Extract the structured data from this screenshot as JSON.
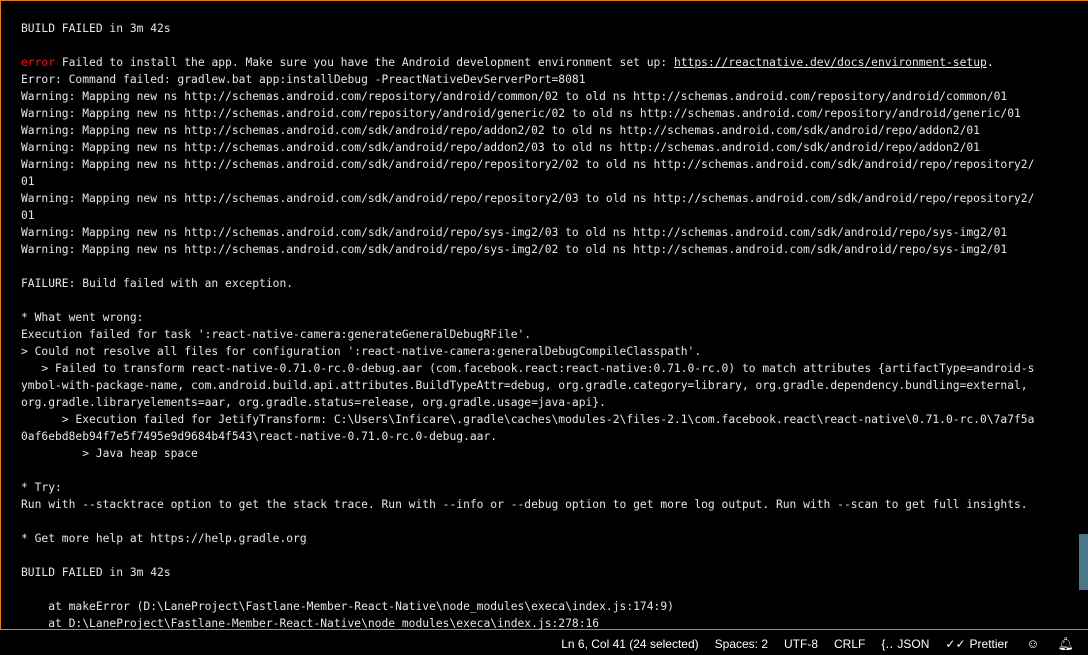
{
  "terminal": {
    "lines": [
      {
        "text": "BUILD FAILED in 3m 42s"
      },
      {
        "text": ""
      },
      {
        "prefix": "error",
        "text": " Failed to install the app. Make sure you have the Android development environment set up: ",
        "link": "https://reactnative.dev/docs/environment-setup",
        "suffix": "."
      },
      {
        "text": "Error: Command failed: gradlew.bat app:installDebug -PreactNativeDevServerPort=8081"
      },
      {
        "text": "Warning: Mapping new ns http://schemas.android.com/repository/android/common/02 to old ns http://schemas.android.com/repository/android/common/01"
      },
      {
        "text": "Warning: Mapping new ns http://schemas.android.com/repository/android/generic/02 to old ns http://schemas.android.com/repository/android/generic/01"
      },
      {
        "text": "Warning: Mapping new ns http://schemas.android.com/sdk/android/repo/addon2/02 to old ns http://schemas.android.com/sdk/android/repo/addon2/01"
      },
      {
        "text": "Warning: Mapping new ns http://schemas.android.com/sdk/android/repo/addon2/03 to old ns http://schemas.android.com/sdk/android/repo/addon2/01"
      },
      {
        "text": "Warning: Mapping new ns http://schemas.android.com/sdk/android/repo/repository2/02 to old ns http://schemas.android.com/sdk/android/repo/repository2/"
      },
      {
        "text": "01"
      },
      {
        "text": "Warning: Mapping new ns http://schemas.android.com/sdk/android/repo/repository2/03 to old ns http://schemas.android.com/sdk/android/repo/repository2/"
      },
      {
        "text": "01"
      },
      {
        "text": "Warning: Mapping new ns http://schemas.android.com/sdk/android/repo/sys-img2/03 to old ns http://schemas.android.com/sdk/android/repo/sys-img2/01"
      },
      {
        "text": "Warning: Mapping new ns http://schemas.android.com/sdk/android/repo/sys-img2/02 to old ns http://schemas.android.com/sdk/android/repo/sys-img2/01"
      },
      {
        "text": ""
      },
      {
        "text": "FAILURE: Build failed with an exception."
      },
      {
        "text": ""
      },
      {
        "text": "* What went wrong:"
      },
      {
        "text": "Execution failed for task ':react-native-camera:generateGeneralDebugRFile'."
      },
      {
        "text": "> Could not resolve all files for configuration ':react-native-camera:generalDebugCompileClasspath'."
      },
      {
        "text": "   > Failed to transform react-native-0.71.0-rc.0-debug.aar (com.facebook.react:react-native:0.71.0-rc.0) to match attributes {artifactType=android-s"
      },
      {
        "text": "ymbol-with-package-name, com.android.build.api.attributes.BuildTypeAttr=debug, org.gradle.category=library, org.gradle.dependency.bundling=external,"
      },
      {
        "text": "org.gradle.libraryelements=aar, org.gradle.status=release, org.gradle.usage=java-api}."
      },
      {
        "text": "      > Execution failed for JetifyTransform: C:\\Users\\Inficare\\.gradle\\caches\\modules-2\\files-2.1\\com.facebook.react\\react-native\\0.71.0-rc.0\\7a7f5a"
      },
      {
        "text": "0af6ebd8eb94f7e5f7495e9d9684b4f543\\react-native-0.71.0-rc.0-debug.aar."
      },
      {
        "text": "         > Java heap space"
      },
      {
        "text": ""
      },
      {
        "text": "* Try:"
      },
      {
        "text": "Run with --stacktrace option to get the stack trace. Run with --info or --debug option to get more log output. Run with --scan to get full insights."
      },
      {
        "text": ""
      },
      {
        "text": "* Get more help at https://help.gradle.org"
      },
      {
        "text": ""
      },
      {
        "text": "BUILD FAILED in 3m 42s"
      },
      {
        "text": ""
      },
      {
        "text": "    at makeError (D:\\LaneProject\\Fastlane-Member-React-Native\\node_modules\\execa\\index.js:174:9)"
      },
      {
        "text": "    at D:\\LaneProject\\Fastlane-Member-React-Native\\node_modules\\execa\\index.js:278:16"
      }
    ]
  },
  "statusbar": {
    "cursor_position": "Ln 6, Col 41 (24 selected)",
    "indentation": "Spaces: 2",
    "encoding": "UTF-8",
    "line_ending": "CRLF",
    "language": "JSON",
    "language_icon": "braces-icon",
    "formatter": "Prettier",
    "formatter_icon": "double-check-icon",
    "feedback_icon": "feedback-person-icon",
    "notifications_icon": "bell-icon"
  },
  "colors": {
    "background": "#000000",
    "text": "#e6e6e6",
    "error": "#f21717",
    "panel_border": "#e37d21",
    "scrollbar": "#4a7787"
  }
}
